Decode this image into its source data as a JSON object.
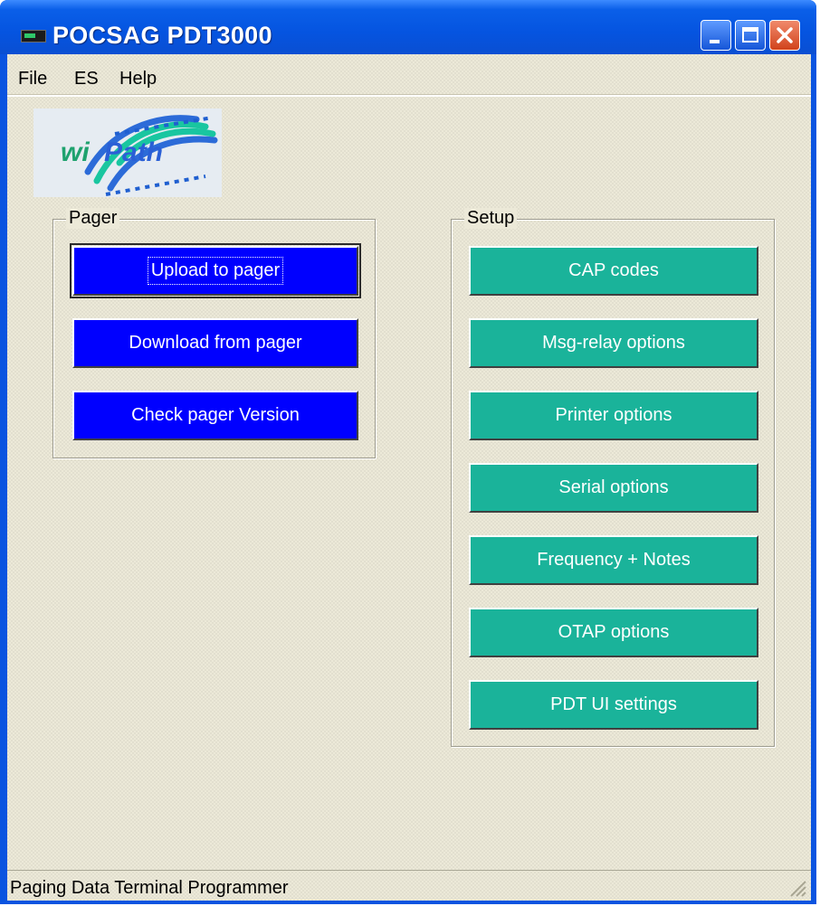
{
  "window": {
    "title": "POCSAG PDT3000"
  },
  "menubar": {
    "items": [
      "File",
      "ES",
      "Help"
    ]
  },
  "logo": {
    "text": "wiPath",
    "icon": "wipath-logo"
  },
  "pager_group": {
    "title": "Pager",
    "buttons": [
      {
        "label": "Upload to pager"
      },
      {
        "label": "Download from pager"
      },
      {
        "label": "Check pager Version"
      }
    ]
  },
  "setup_group": {
    "title": "Setup",
    "buttons": [
      {
        "label": "CAP codes"
      },
      {
        "label": "Msg-relay options"
      },
      {
        "label": "Printer options"
      },
      {
        "label": "Serial options"
      },
      {
        "label": "Frequency + Notes"
      },
      {
        "label": "OTAP options"
      },
      {
        "label": "PDT UI settings"
      }
    ]
  },
  "statusbar": {
    "text": "Paging Data Terminal Programmer"
  },
  "colors": {
    "pager_button": "#0000ff",
    "setup_button": "#1ab39a",
    "titlebar": "#0554e0",
    "background": "#ece9d8"
  }
}
